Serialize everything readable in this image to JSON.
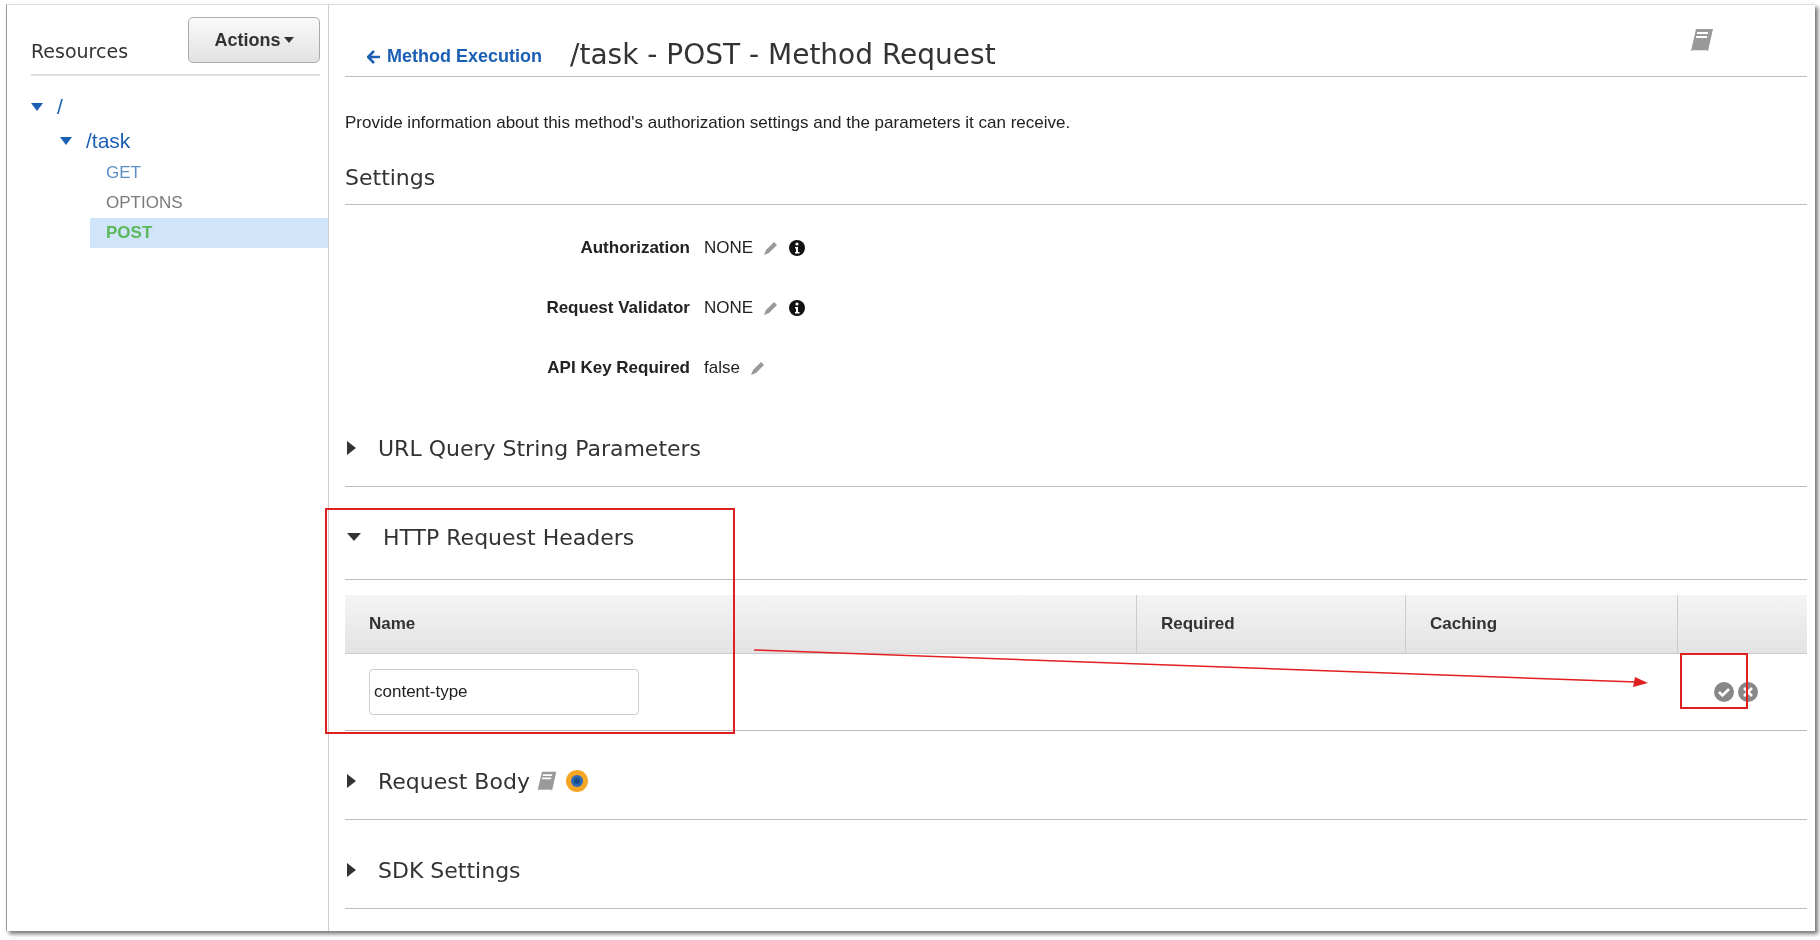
{
  "sidebar": {
    "title": "Resources",
    "actions_button": "Actions",
    "tree": [
      {
        "label": "/",
        "expanded": true,
        "children": [
          {
            "label": "/task",
            "expanded": true,
            "methods": [
              {
                "label": "GET",
                "selected": false,
                "color": "#5a8fc7"
              },
              {
                "label": "OPTIONS",
                "selected": false,
                "color": "#7a7a7a"
              },
              {
                "label": "POST",
                "selected": true,
                "color": "#5cb85c"
              }
            ]
          }
        ]
      }
    ]
  },
  "header": {
    "back_link": "Method Execution",
    "title": "/task - POST - Method Request"
  },
  "description": "Provide information about this method's authorization settings and the parameters it can receive.",
  "settings": {
    "title": "Settings",
    "fields": [
      {
        "label": "Authorization",
        "value": "NONE",
        "info": true
      },
      {
        "label": "Request Validator",
        "value": "NONE",
        "info": true
      },
      {
        "label": "API Key Required",
        "value": "false",
        "info": false
      }
    ]
  },
  "sections": [
    {
      "title": "URL Query String Parameters",
      "expanded": false,
      "kind": "plain"
    },
    {
      "title": "HTTP Request Headers",
      "expanded": true,
      "kind": "table",
      "columns": [
        "Name",
        "Required",
        "Caching"
      ],
      "rows": [
        {
          "name": "content-type"
        }
      ]
    },
    {
      "title": "Request Body",
      "expanded": false,
      "kind": "model"
    },
    {
      "title": "SDK Settings",
      "expanded": false,
      "kind": "plain"
    }
  ]
}
